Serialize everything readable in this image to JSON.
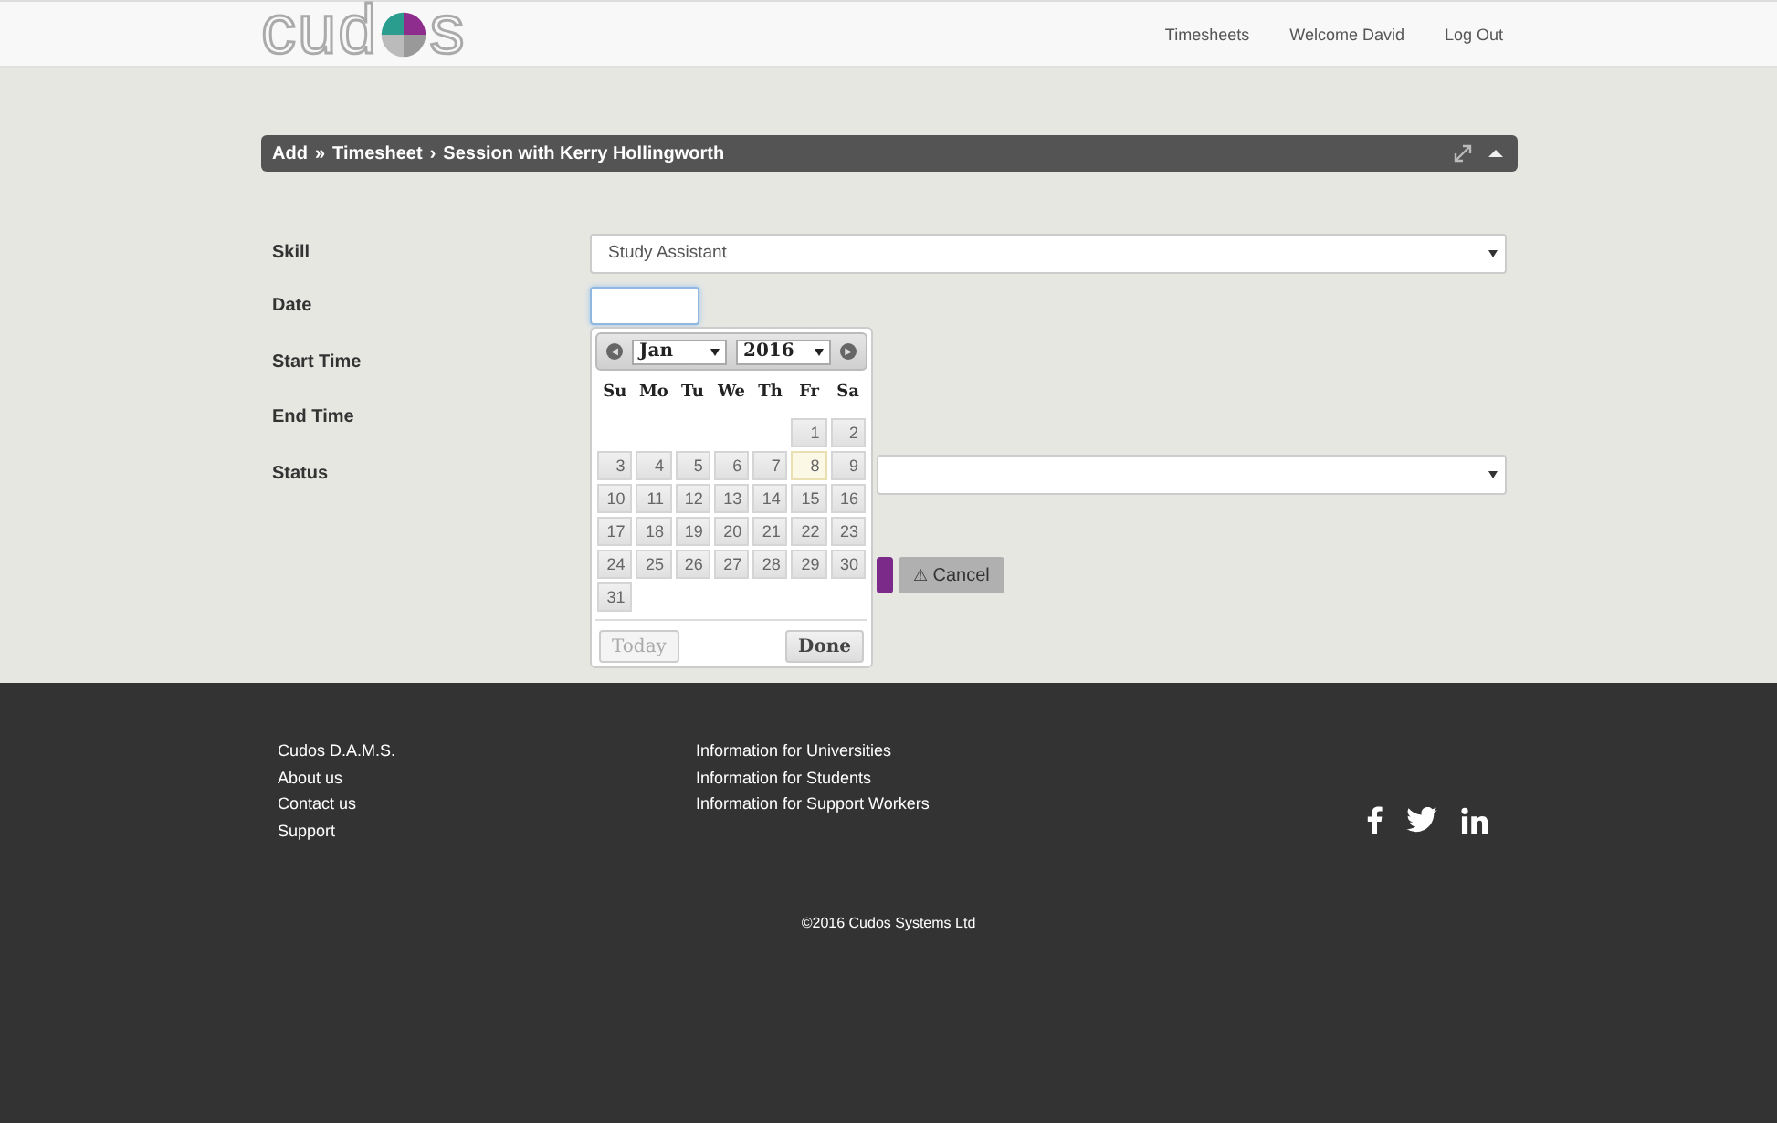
{
  "header": {
    "logo": {
      "before": "cud",
      "after": "s"
    },
    "nav": [
      "Timesheets",
      "Welcome David",
      "Log Out"
    ]
  },
  "panel": {
    "breadcrumb": [
      {
        "text": "Add",
        "separator": "»"
      },
      {
        "text": "Timesheet",
        "separator": "›"
      },
      {
        "text": "Session with Kerry Hollingworth"
      }
    ]
  },
  "form": {
    "fields": [
      {
        "label": "Skill",
        "kind": "select",
        "value": "Study Assistant"
      },
      {
        "label": "Date",
        "kind": "date",
        "focused": true
      },
      {
        "label": "Start Time",
        "kind": "hidden"
      },
      {
        "label": "End Time",
        "kind": "hidden"
      },
      {
        "label": "Status",
        "kind": "select-partial"
      }
    ],
    "buttons": [
      {
        "kind": "primary"
      },
      {
        "kind": "cancel",
        "icon": "⚠",
        "label": "Cancel"
      }
    ]
  },
  "datepicker": {
    "prev": "◀",
    "next": "▶",
    "month": "Jan",
    "year": "2016",
    "weekdays": [
      "Su",
      "Mo",
      "Tu",
      "We",
      "Th",
      "Fr",
      "Sa"
    ],
    "weeks": [
      [
        {
          "kind": "blank"
        },
        {
          "kind": "blank"
        },
        {
          "kind": "blank"
        },
        {
          "kind": "blank"
        },
        {
          "kind": "blank"
        },
        {
          "kind": "day",
          "day": "1",
          "today": false
        },
        {
          "kind": "day",
          "day": "2",
          "today": false
        }
      ],
      [
        {
          "kind": "day",
          "day": "3",
          "today": false
        },
        {
          "kind": "day",
          "day": "4",
          "today": false
        },
        {
          "kind": "day",
          "day": "5",
          "today": false
        },
        {
          "kind": "day",
          "day": "6",
          "today": false
        },
        {
          "kind": "day",
          "day": "7",
          "today": false
        },
        {
          "kind": "day",
          "day": "8",
          "today": true
        },
        {
          "kind": "day",
          "day": "9",
          "today": false
        }
      ],
      [
        {
          "kind": "day",
          "day": "10",
          "today": false
        },
        {
          "kind": "day",
          "day": "11",
          "today": false
        },
        {
          "kind": "day",
          "day": "12",
          "today": false
        },
        {
          "kind": "day",
          "day": "13",
          "today": false
        },
        {
          "kind": "day",
          "day": "14",
          "today": false
        },
        {
          "kind": "day",
          "day": "15",
          "today": false
        },
        {
          "kind": "day",
          "day": "16",
          "today": false
        }
      ],
      [
        {
          "kind": "day",
          "day": "17",
          "today": false
        },
        {
          "kind": "day",
          "day": "18",
          "today": false
        },
        {
          "kind": "day",
          "day": "19",
          "today": false
        },
        {
          "kind": "day",
          "day": "20",
          "today": false
        },
        {
          "kind": "day",
          "day": "21",
          "today": false
        },
        {
          "kind": "day",
          "day": "22",
          "today": false
        },
        {
          "kind": "day",
          "day": "23",
          "today": false
        }
      ],
      [
        {
          "kind": "day",
          "day": "24",
          "today": false
        },
        {
          "kind": "day",
          "day": "25",
          "today": false
        },
        {
          "kind": "day",
          "day": "26",
          "today": false
        },
        {
          "kind": "day",
          "day": "27",
          "today": false
        },
        {
          "kind": "day",
          "day": "28",
          "today": false
        },
        {
          "kind": "day",
          "day": "29",
          "today": false
        },
        {
          "kind": "day",
          "day": "30",
          "today": false
        }
      ],
      [
        {
          "kind": "day",
          "day": "31",
          "today": false
        }
      ]
    ],
    "today_button": {
      "label": "Today",
      "disabled": true
    },
    "done_button": {
      "label": "Done",
      "disabled": false
    }
  },
  "footer": {
    "columns": [
      [
        "Cudos D.A.M.S.",
        "About us",
        "Contact us",
        "Support"
      ],
      [
        "Information for Universities",
        "Information for Students",
        "Information for Support Workers"
      ]
    ],
    "social": [
      {
        "kind": "facebook"
      },
      {
        "kind": "twitter"
      },
      {
        "kind": "linkedin"
      }
    ],
    "copyright": "©2016 Cudos Systems Ltd"
  }
}
